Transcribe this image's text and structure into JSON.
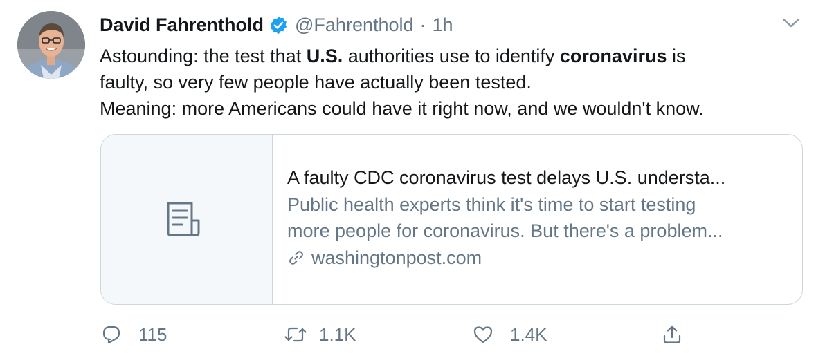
{
  "author": {
    "display_name": "David Fahrenthold",
    "handle": "@Fahrenthold",
    "separator": "·",
    "time": "1h",
    "verified": true,
    "avatar_icon": "user-photo-avatar"
  },
  "body": {
    "line1_a": "Astounding: the test that ",
    "line1_b": "U.S.",
    "line1_c": " authorities use to identify ",
    "line1_d": "coronavirus",
    "line1_e": " is",
    "line2": "faulty, so very few people have actually been tested.",
    "line3": "Meaning: more Americans could have it right now, and we wouldn't know."
  },
  "card": {
    "thumbnail_icon": "document-icon",
    "title": "A faulty CDC coronavirus test delays U.S. understa...",
    "description_line1": "Public health experts think it's time to start testing",
    "description_line2": "more people for coronavirus. But there's a problem...",
    "domain_icon": "link-icon",
    "domain": "washingtonpost.com"
  },
  "actions": {
    "reply_count": "115",
    "retweet_count": "1.1K",
    "like_count": "1.4K"
  },
  "colors": {
    "text": "#14171a",
    "secondary": "#657786",
    "border": "#ccd6dd",
    "verified_blue": "#1da1f2",
    "card_thumb_bg": "#f5f8fa"
  }
}
